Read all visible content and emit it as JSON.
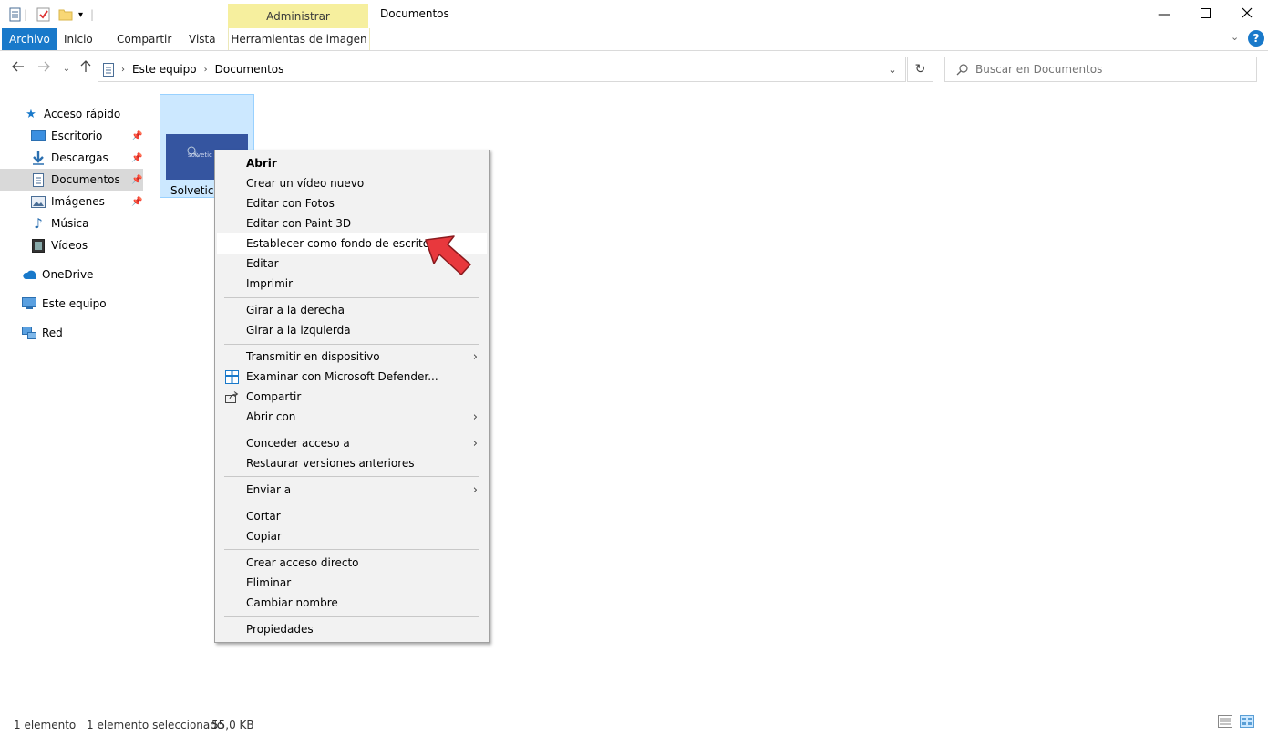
{
  "window": {
    "title": "Documentos",
    "contextual_group": "Administrar"
  },
  "ribbon": {
    "tabs": [
      "Archivo",
      "Inicio",
      "Compartir",
      "Vista"
    ],
    "contextual_tab": "Herramientas de imagen",
    "help": "?"
  },
  "address": {
    "crumbs": [
      "Este equipo",
      "Documentos"
    ]
  },
  "search": {
    "placeholder": "Buscar en Documentos"
  },
  "sidebar": {
    "quick_access": "Acceso rápido",
    "items": [
      {
        "label": "Escritorio",
        "icon": "desktop-icon"
      },
      {
        "label": "Descargas",
        "icon": "download-icon"
      },
      {
        "label": "Documentos",
        "icon": "document-icon"
      },
      {
        "label": "Imágenes",
        "icon": "pictures-icon"
      },
      {
        "label": "Música",
        "icon": "music-icon"
      },
      {
        "label": "Vídeos",
        "icon": "videos-icon"
      }
    ],
    "onedrive": "OneDrive",
    "this_pc": "Este equipo",
    "network": "Red"
  },
  "file": {
    "name": "Solvetic (",
    "thumb_text": "solvetic"
  },
  "context_menu": {
    "items": [
      {
        "label": "Abrir",
        "bold": true
      },
      {
        "label": "Crear un vídeo nuevo"
      },
      {
        "label": "Editar con Fotos"
      },
      {
        "label": "Editar con Paint 3D"
      },
      {
        "label": "Establecer como fondo de escritorio",
        "hover": true
      },
      {
        "label": "Editar"
      },
      {
        "label": "Imprimir"
      },
      {
        "label": "Girar a la derecha"
      },
      {
        "label": "Girar a la izquierda"
      },
      {
        "label": "Transmitir en dispositivo",
        "submenu": true
      },
      {
        "label": "Examinar con Microsoft Defender...",
        "icon": "defender-icon"
      },
      {
        "label": "Compartir",
        "icon": "share-icon"
      },
      {
        "label": "Abrir con",
        "submenu": true
      },
      {
        "label": "Conceder acceso a",
        "submenu": true
      },
      {
        "label": "Restaurar versiones anteriores"
      },
      {
        "label": "Enviar a",
        "submenu": true
      },
      {
        "label": "Cortar"
      },
      {
        "label": "Copiar"
      },
      {
        "label": "Crear acceso directo"
      },
      {
        "label": "Eliminar"
      },
      {
        "label": "Cambiar nombre"
      },
      {
        "label": "Propiedades"
      }
    ]
  },
  "status": {
    "count": "1 elemento",
    "selected": "1 elemento seleccionado",
    "size": "55,0 KB"
  },
  "colors": {
    "accent": "#1979ca",
    "contextual": "#f6ef9e",
    "selection": "#cce8ff",
    "annotation_arrow": "#e8383d"
  }
}
